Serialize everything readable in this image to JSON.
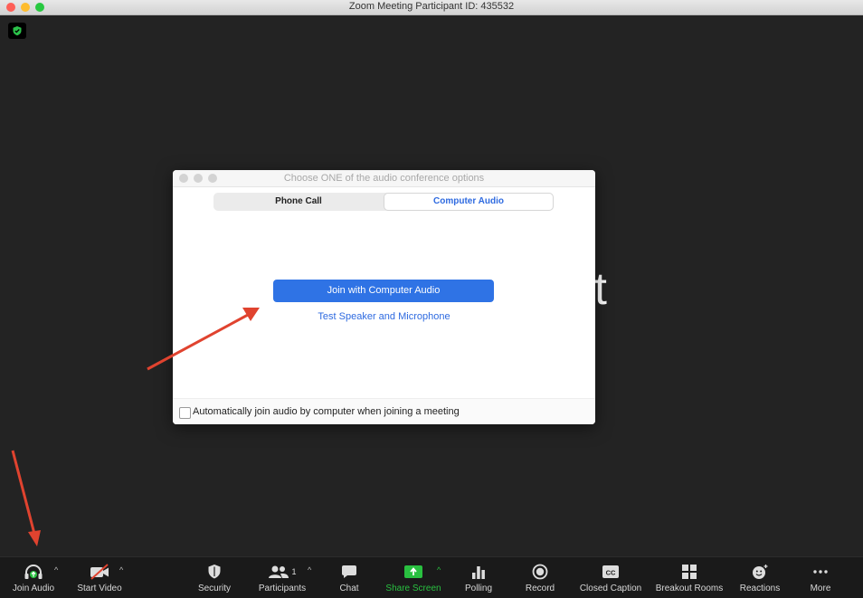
{
  "window": {
    "title": "Zoom Meeting Participant ID: 435532"
  },
  "meeting": {
    "background_text": "t"
  },
  "dialog": {
    "title": "Choose ONE of the audio conference options",
    "tabs": [
      "Phone Call",
      "Computer Audio"
    ],
    "selected_tab": "Computer Audio",
    "join_button": "Join with Computer Audio",
    "test_link": "Test Speaker and Microphone",
    "auto_join_label": "Automatically join audio by computer when joining a meeting",
    "auto_join_checked": false
  },
  "toolbar": {
    "join_audio": "Join Audio",
    "start_video": "Start Video",
    "security": "Security",
    "participants": "Participants",
    "participants_count": "1",
    "chat": "Chat",
    "share_screen": "Share Screen",
    "polling": "Polling",
    "record": "Record",
    "closed_caption": "Closed Caption",
    "breakout_rooms": "Breakout Rooms",
    "reactions": "Reactions",
    "more": "More"
  },
  "colors": {
    "accent": "#2f73e5",
    "share_green": "#29c040",
    "arrow": "#e0432f"
  }
}
